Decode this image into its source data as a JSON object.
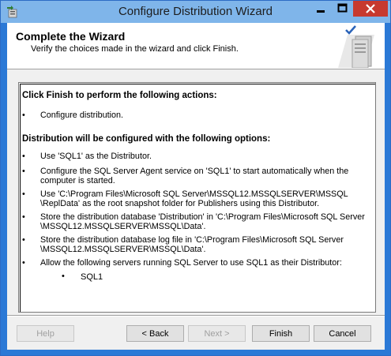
{
  "window": {
    "title": "Configure Distribution Wizard"
  },
  "header": {
    "title": "Complete the Wizard",
    "subtitle": "Verify the choices made in the wizard and click Finish."
  },
  "content": {
    "actions_heading": "Click Finish to perform the following actions:",
    "actions": [
      "Configure distribution."
    ],
    "options_heading": "Distribution will be configured with the following options:",
    "options": [
      {
        "lines": [
          "Use 'SQL1' as the Distributor."
        ]
      },
      {
        "lines": [
          "Configure the SQL Server Agent service on 'SQL1' to start automatically when the",
          "computer is started."
        ]
      },
      {
        "lines": [
          "Use 'C:\\Program Files\\Microsoft SQL Server\\MSSQL12.MSSQLSERVER\\MSSQL",
          "\\ReplData' as the root snapshot folder for Publishers using this Distributor."
        ]
      },
      {
        "lines": [
          "Store the distribution database 'Distribution' in 'C:\\Program Files\\Microsoft SQL Server",
          "\\MSSQL12.MSSQLSERVER\\MSSQL\\Data'."
        ]
      },
      {
        "lines": [
          "Store the distribution database log file in 'C:\\Program Files\\Microsoft SQL Server",
          "\\MSSQL12.MSSQLSERVER\\MSSQL\\Data'."
        ]
      },
      {
        "lines": [
          "Allow the following servers running SQL Server to use SQL1 as their Distributor:"
        ]
      }
    ],
    "servers": [
      "SQL1"
    ],
    "bullet": "•"
  },
  "buttons": {
    "help": "Help",
    "back": "< Back",
    "next": "Next >",
    "finish": "Finish",
    "cancel": "Cancel"
  },
  "icons": {
    "app": "wizard-app-icon",
    "header": "server-check-icon",
    "minimize": "minimize-icon",
    "maximize": "maximize-icon",
    "close": "close-icon"
  },
  "colors": {
    "titlebar": "#7fb5ea",
    "frame": "#2b79d6",
    "close_button": "#c7392f"
  }
}
